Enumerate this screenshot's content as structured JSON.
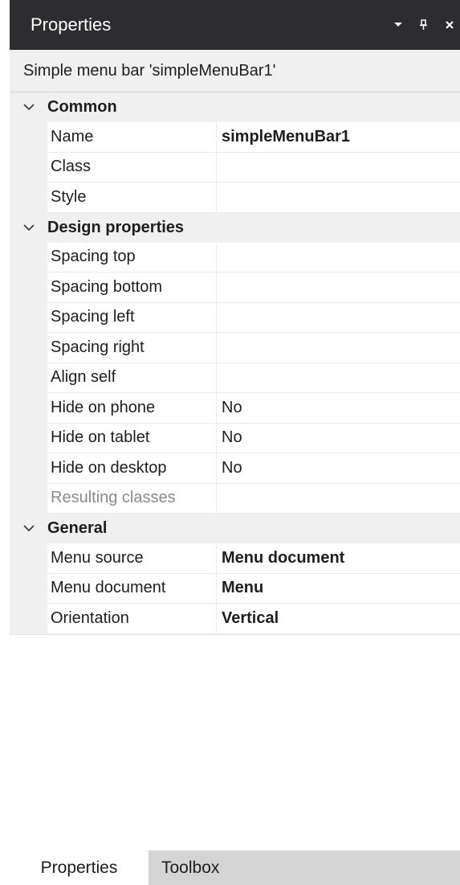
{
  "panel": {
    "title": "Properties",
    "icons": [
      "dropdown-arrow-icon",
      "pin-icon",
      "close-icon"
    ]
  },
  "subject": "Simple menu bar 'simpleMenuBar1'",
  "categories": [
    {
      "label": "Common",
      "rows": [
        {
          "name": "Name",
          "value": "simpleMenuBar1",
          "bold": true
        },
        {
          "name": "Class",
          "value": ""
        },
        {
          "name": "Style",
          "value": ""
        }
      ]
    },
    {
      "label": "Design properties",
      "rows": [
        {
          "name": "Spacing top",
          "value": ""
        },
        {
          "name": "Spacing bottom",
          "value": ""
        },
        {
          "name": "Spacing left",
          "value": ""
        },
        {
          "name": "Spacing right",
          "value": ""
        },
        {
          "name": "Align self",
          "value": ""
        },
        {
          "name": "Hide on phone",
          "value": "No"
        },
        {
          "name": "Hide on tablet",
          "value": "No"
        },
        {
          "name": "Hide on desktop",
          "value": "No"
        },
        {
          "name": "Resulting classes",
          "value": "",
          "disabled": true
        }
      ]
    },
    {
      "label": "General",
      "rows": [
        {
          "name": "Menu source",
          "value": "Menu document",
          "bold": true
        },
        {
          "name": "Menu document",
          "value": "Menu",
          "bold": true
        },
        {
          "name": "Orientation",
          "value": "Vertical",
          "bold": true
        }
      ]
    }
  ],
  "tabs": [
    {
      "label": "Properties",
      "active": true
    },
    {
      "label": "Toolbox",
      "active": false
    }
  ]
}
